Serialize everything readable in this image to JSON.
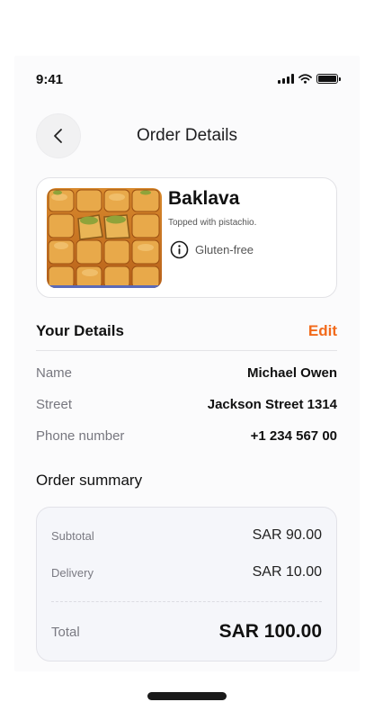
{
  "status_bar": {
    "time": "9:41"
  },
  "header": {
    "title": "Order Details",
    "back_icon": "chevron-left-icon"
  },
  "product": {
    "name": "Baklava",
    "description": "Topped with pistachio.",
    "tag": "Gluten-free",
    "tag_icon": "info-icon",
    "image": "baklava-photo"
  },
  "details": {
    "title": "Your Details",
    "edit_label": "Edit",
    "accent": "#f26a1b",
    "rows": [
      {
        "label": "Name",
        "value": "Michael Owen"
      },
      {
        "label": "Street",
        "value": "Jackson Street 1314"
      },
      {
        "label": "Phone number",
        "value": "+1 234 567 00"
      }
    ]
  },
  "summary": {
    "title": "Order summary",
    "subtotal_label": "Subtotal",
    "subtotal_value": "SAR 90.00",
    "delivery_label": "Delivery",
    "delivery_value": "SAR 10.00",
    "total_label": "Total",
    "total_value": "SAR 100.00"
  }
}
